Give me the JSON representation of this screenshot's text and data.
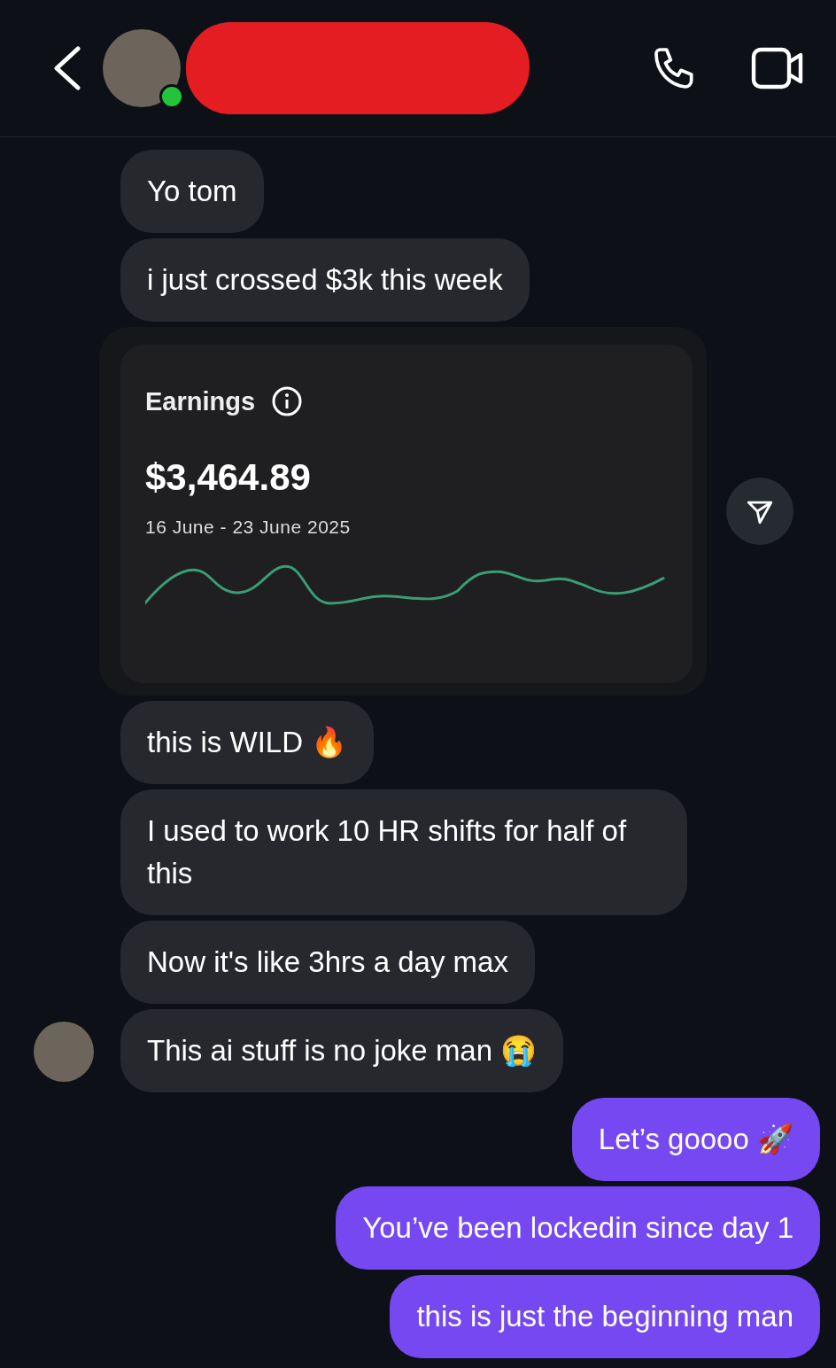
{
  "header": {
    "online": true,
    "redacted": true
  },
  "messages": [
    {
      "kind": "received",
      "text": "Yo tom",
      "show_avatar": false
    },
    {
      "kind": "received",
      "text": "i just crossed $3k this week",
      "show_avatar": false
    },
    {
      "kind": "received_card",
      "title": "Earnings",
      "amount": "$3,464.89",
      "period": "16 June - 23 June 2025",
      "show_avatar": false
    },
    {
      "kind": "received",
      "text": "this is WILD 🔥",
      "show_avatar": false
    },
    {
      "kind": "received",
      "text": "I used to work 10 HR shifts for half of this",
      "show_avatar": false
    },
    {
      "kind": "received",
      "text": "Now it's like 3hrs a day max",
      "show_avatar": false
    },
    {
      "kind": "received",
      "text": "This ai stuff is no joke man 😭",
      "show_avatar": true
    },
    {
      "kind": "sent",
      "text": "Let’s goooo 🚀"
    },
    {
      "kind": "sent",
      "text": "You’ve been lockedin since day 1"
    },
    {
      "kind": "sent",
      "text": "this is just the beginning man"
    }
  ]
}
